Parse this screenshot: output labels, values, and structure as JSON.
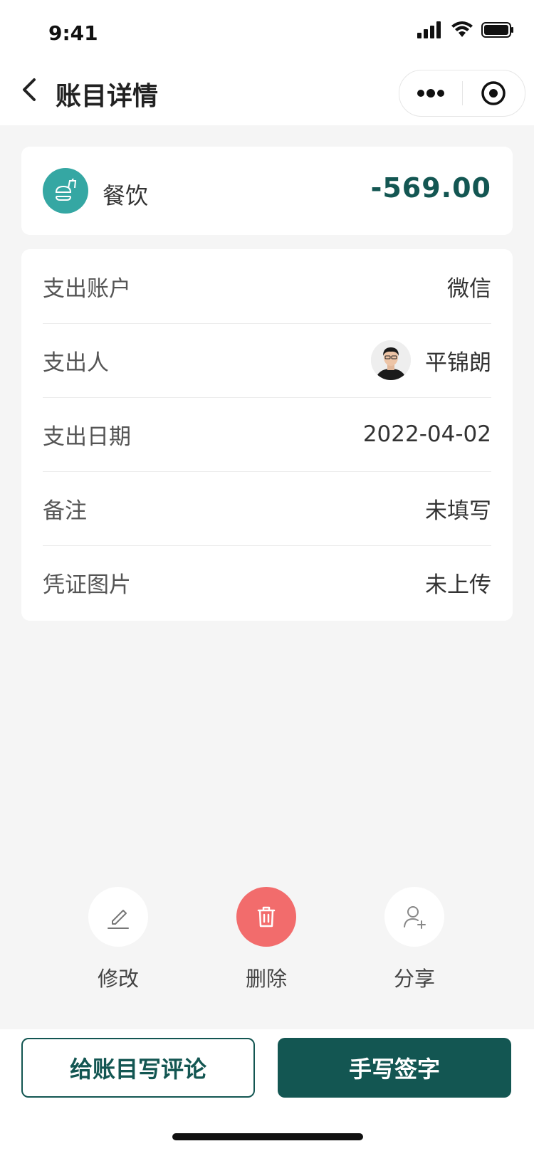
{
  "status_bar": {
    "time": "9:41"
  },
  "nav": {
    "title": "账目详情"
  },
  "summary": {
    "category": "餐饮",
    "amount": "-569.00"
  },
  "details": [
    {
      "label": "支出账户",
      "value": "微信"
    },
    {
      "label": "支出人",
      "value": "平锦朗"
    },
    {
      "label": "支出日期",
      "value": "2022-04-02"
    },
    {
      "label": "备注",
      "value": "未填写"
    },
    {
      "label": "凭证图片",
      "value": "未上传"
    }
  ],
  "actions": [
    {
      "label": "修改",
      "icon": "pencil-icon"
    },
    {
      "label": "删除",
      "icon": "trash-icon"
    },
    {
      "label": "分享",
      "icon": "user-add-icon"
    }
  ],
  "buttons": {
    "comment": "给账目写评论",
    "sign": "手写签字"
  },
  "colors": {
    "primary": "#135652",
    "category_icon_bg": "#35a7a3",
    "danger": "#f26c6c"
  }
}
